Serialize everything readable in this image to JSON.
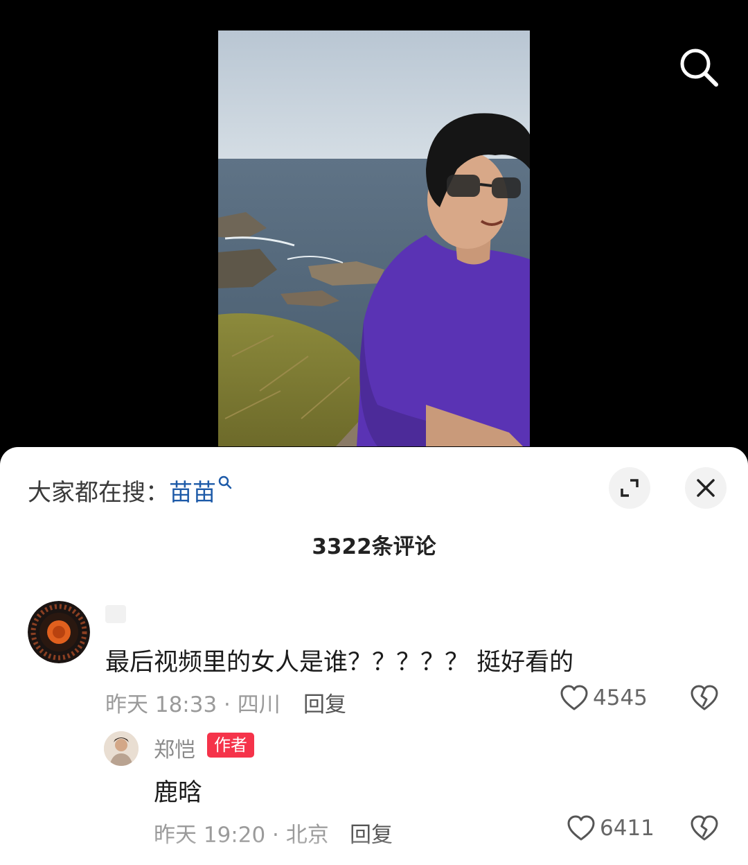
{
  "hot_search": {
    "prefix": "大家都在搜：",
    "keyword": "苗苗"
  },
  "comment_count": "3322条评论",
  "comments": [
    {
      "text": "最后视频里的女人是谁？？？？？ 挺好看的",
      "meta": "昨天 18:33 · 四川",
      "reply_label": "回复",
      "likes": "4545"
    }
  ],
  "reply": {
    "username": "郑恺",
    "badge": "作者",
    "text": "鹿晗",
    "meta": "昨天 19:20 · 北京",
    "reply_label": "回复",
    "likes": "6411"
  },
  "colors": {
    "keyword": "#1d5aa8",
    "author_badge": "#f5334a",
    "sweater": "#5a33b4"
  },
  "icons": [
    "search-icon",
    "expand-icon",
    "close-icon",
    "heart-icon",
    "broken-heart-icon"
  ]
}
